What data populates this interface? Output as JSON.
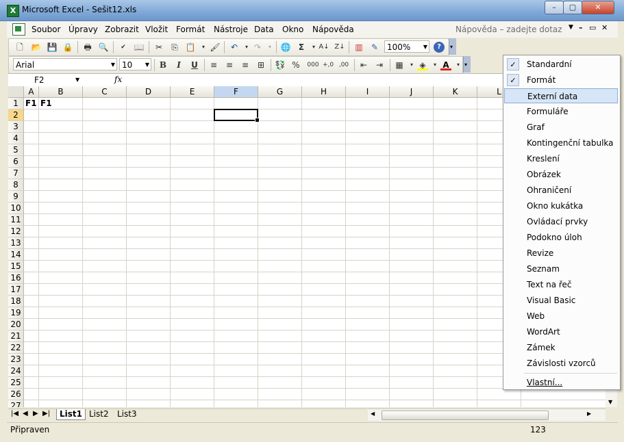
{
  "window": {
    "title": "Microsoft Excel - Sešit12.xls",
    "app_icon": "X",
    "min": "–",
    "max": "▢",
    "close": "✕"
  },
  "menubar": {
    "items": [
      "Soubor",
      "Úpravy",
      "Zobrazit",
      "Vložit",
      "Formát",
      "Nástroje",
      "Data",
      "Okno",
      "Nápověda"
    ],
    "help_placeholder": "Nápověda – zadejte dotaz",
    "mdi": [
      "–",
      "▭",
      "✕"
    ]
  },
  "toolbar_standard": {
    "zoom": "100%"
  },
  "toolbar_format": {
    "font": "Arial",
    "size": "10",
    "bold": "B",
    "italic": "I",
    "underline": "U",
    "percent": "%",
    "thousands": "000"
  },
  "formula_bar": {
    "cell_ref": "F2",
    "fx": "fx"
  },
  "grid": {
    "columns": [
      "A",
      "B",
      "C",
      "D",
      "E",
      "F",
      "G",
      "H",
      "I",
      "J",
      "K",
      "L"
    ],
    "selected_column": "F",
    "rows": [
      "1",
      "2",
      "3",
      "4",
      "5",
      "6",
      "7",
      "8",
      "9",
      "10",
      "11",
      "12",
      "13",
      "14",
      "15",
      "16",
      "17",
      "18",
      "19",
      "20",
      "21",
      "22",
      "23",
      "24",
      "25",
      "26",
      "27"
    ],
    "selected_row": "2",
    "cells": {
      "A1": "F1",
      "B1": "F1"
    }
  },
  "sheets": {
    "tabs": [
      "List1",
      "List2",
      "List3"
    ],
    "active": "List1"
  },
  "status": {
    "left": "Připraven",
    "right": "123"
  },
  "toolbars_menu": {
    "items": [
      {
        "label": "Standardní",
        "checked": true
      },
      {
        "label": "Formát",
        "checked": true
      },
      {
        "label": "Externí data",
        "checked": false,
        "highlighted": true
      },
      {
        "label": "Formuláře",
        "checked": false
      },
      {
        "label": "Graf",
        "checked": false
      },
      {
        "label": "Kontingenční tabulka",
        "checked": false
      },
      {
        "label": "Kreslení",
        "checked": false
      },
      {
        "label": "Obrázek",
        "checked": false
      },
      {
        "label": "Ohraničení",
        "checked": false
      },
      {
        "label": "Okno kukátka",
        "checked": false
      },
      {
        "label": "Ovládací prvky",
        "checked": false
      },
      {
        "label": "Podokno úloh",
        "checked": false
      },
      {
        "label": "Revize",
        "checked": false
      },
      {
        "label": "Seznam",
        "checked": false
      },
      {
        "label": "Text na řeč",
        "checked": false
      },
      {
        "label": "Visual Basic",
        "checked": false
      },
      {
        "label": "Web",
        "checked": false
      },
      {
        "label": "WordArt",
        "checked": false
      },
      {
        "label": "Zámek",
        "checked": false
      },
      {
        "label": "Závislosti vzorců",
        "checked": false
      },
      {
        "label": "Vlastní...",
        "checked": false
      }
    ]
  }
}
